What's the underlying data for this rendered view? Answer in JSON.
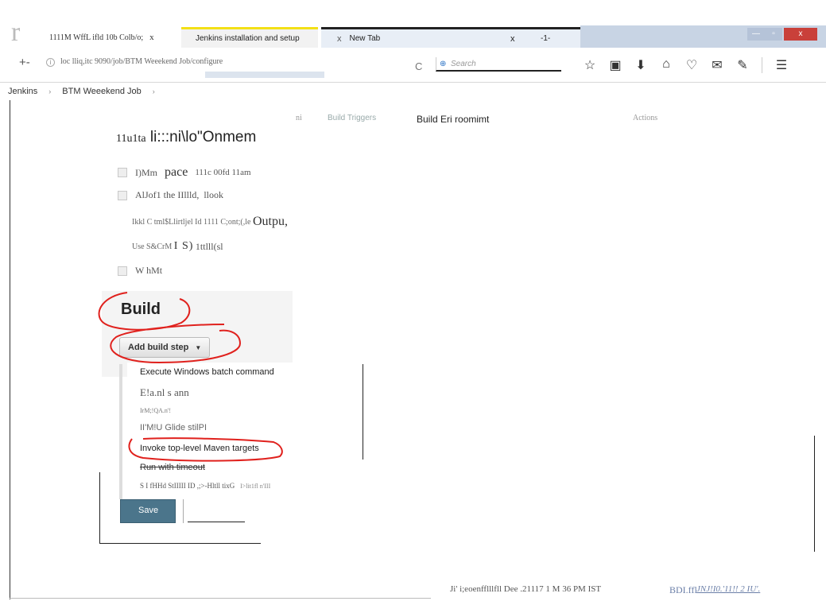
{
  "browser": {
    "logo": "r",
    "tabs": [
      {
        "label": "1111M WffL ifld 10b Colb/o;",
        "close": "x"
      },
      {
        "label": "Jenkins installation and setup"
      },
      {
        "close": "x",
        "label": "New Tab",
        "extra_close": "x",
        "extra": "-1-"
      }
    ],
    "window": {
      "minimize": "—",
      "maximize": "▫",
      "close": "x"
    },
    "nav": {
      "back": "+-",
      "url": "loc lliq,itc 9090/job/BTM Weeekend Job/configure",
      "reload": "C",
      "search_placeholder": "Search"
    },
    "toolbar_icons": [
      "star-icon",
      "clipboard-icon",
      "download-icon",
      "home-icon",
      "pocket-icon",
      "chat-icon",
      "extension-icon",
      "menu-icon"
    ]
  },
  "jenkins": {
    "breadcrumbs": [
      "Jenkins",
      "BTM Weeekend Job"
    ],
    "breadcrumb_sep": "›",
    "config_tabs": [
      "ni",
      "Build Triggers",
      "Build Eri  roomimt",
      "Actions"
    ],
    "section": {
      "prefix": "11u1ta",
      "title": "li:::ni\\lo\"Onmem"
    },
    "options": [
      {
        "checkbox": "J",
        "a": "I)Mm",
        "b": "pace",
        "c": "111c 00fd 11am"
      },
      {
        "checkbox": "J",
        "a": "AlJof1 the IIllld,",
        "b": "",
        "c": "llook"
      },
      {
        "a": "Ikkl C tml$Llirtljel Id 1111 C;ont;(,le",
        "b": "Outpu,"
      },
      {
        "a": "Use S&CrM",
        "b": "I S)",
        "c": "1ttlll(sl"
      },
      {
        "checkbox": "",
        "a": "W hMt"
      }
    ],
    "build": {
      "heading": "Build",
      "add_step": "Add build step",
      "menu": [
        "Execute Windows batch command",
        "E!a.nl s ann",
        "IrM;!QA.n'!",
        "II'M!U Glide stilPI",
        "Invoke top-level Maven targets",
        "Run with timeout",
        "S I fHHd StIIIII ID ,;>-Hltll tixG",
        "I>lit1fl n'III"
      ],
      "save": "Save"
    },
    "footer": {
      "generated": "Ji' i;eoenfflllfll Dee  .21117 1 M 36 PM IST",
      "version": "BDI.ffl",
      "link": "JNJ!I0.'11!! 2 IU'."
    }
  },
  "colors": {
    "save_button": "#4b758b",
    "annotation": "#e0211d",
    "tab_accent": "#f3e016"
  }
}
